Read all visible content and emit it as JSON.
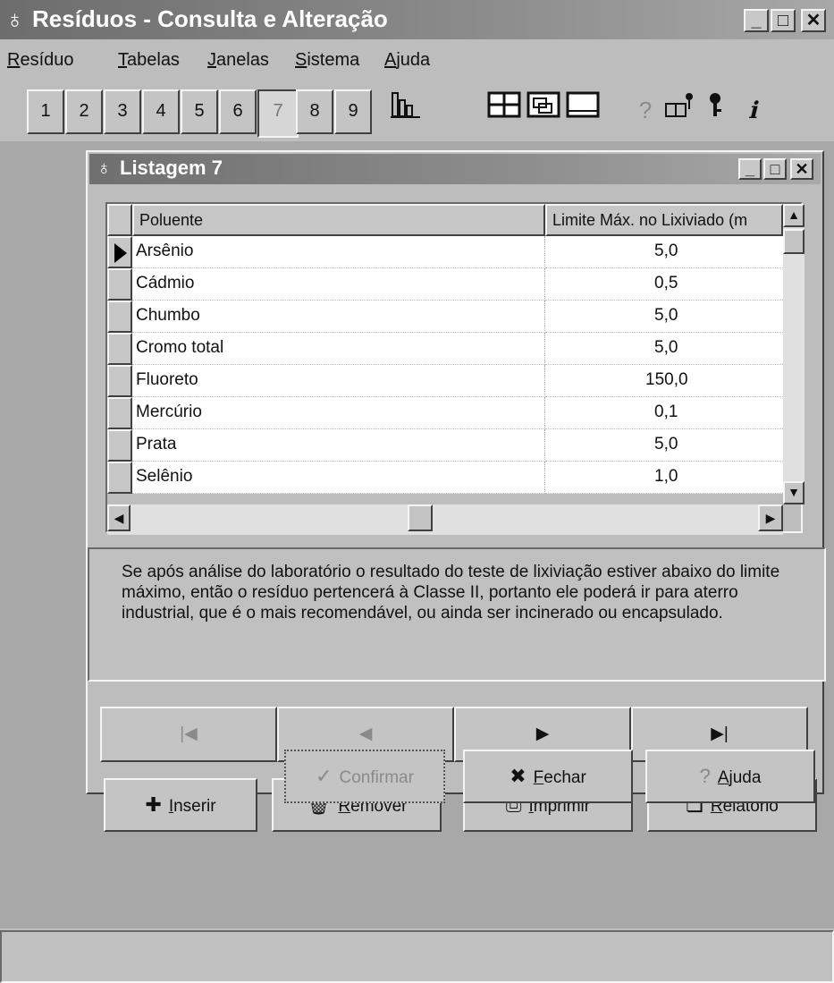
{
  "window": {
    "title": "Resíduos - Consulta e Alteração",
    "controls": [
      "_",
      "□",
      "✕"
    ]
  },
  "menu": [
    {
      "accel": "R",
      "rest": "esíduo"
    },
    {
      "accel": "T",
      "rest": "abelas"
    },
    {
      "accel": "J",
      "rest": "anelas"
    },
    {
      "accel": "S",
      "rest": "istema"
    },
    {
      "accel": "A",
      "rest": "juda"
    }
  ],
  "toolbar": {
    "numbers": [
      "1",
      "2",
      "3",
      "4",
      "5",
      "6",
      "7",
      "8",
      "9"
    ],
    "pressed": "7",
    "icons": [
      "chart-icon",
      "grid-icon",
      "cascade-icon",
      "window-icon",
      "help-icon",
      "book-key-icon",
      "key-icon",
      "info-icon"
    ]
  },
  "child": {
    "title": "Listagem 7",
    "columns": [
      "Poluente",
      "Limite Máx. no Lixiviado (m"
    ],
    "rows": [
      {
        "name": "Arsênio",
        "value": "5,0"
      },
      {
        "name": "Cádmio",
        "value": "0,5"
      },
      {
        "name": "Chumbo",
        "value": "5,0"
      },
      {
        "name": "Cromo total",
        "value": "5,0"
      },
      {
        "name": "Fluoreto",
        "value": "150,0"
      },
      {
        "name": "Mercúrio",
        "value": "0,1"
      },
      {
        "name": "Prata",
        "value": "5,0"
      },
      {
        "name": "Selênio",
        "value": "1,0"
      }
    ],
    "info": "Se após análise do laboratório o resultado do teste de lixiviação estiver abaixo do limite máximo, então o resíduo pertencerá à Classe II, portanto ele poderá ir para aterro industrial, que é o mais recomendável, ou ainda  ser  incinerado ou encapsulado.",
    "nav": {
      "first": "|◀",
      "prev": "◀",
      "next": "▶",
      "last": "▶|"
    },
    "buttons": {
      "inserir": {
        "accel": "I",
        "rest": "nserir"
      },
      "remover": {
        "accel": "R",
        "rest": "emover"
      },
      "imprimir": {
        "accel": "I",
        "rest": "mprimir"
      },
      "relatorio": {
        "accel": "R",
        "rest": "elatório"
      },
      "confirmar": {
        "label": "Confirmar"
      },
      "fechar": {
        "accel": "F",
        "rest": "echar"
      },
      "ajuda": {
        "accel": "A",
        "rest": "juda"
      }
    }
  }
}
